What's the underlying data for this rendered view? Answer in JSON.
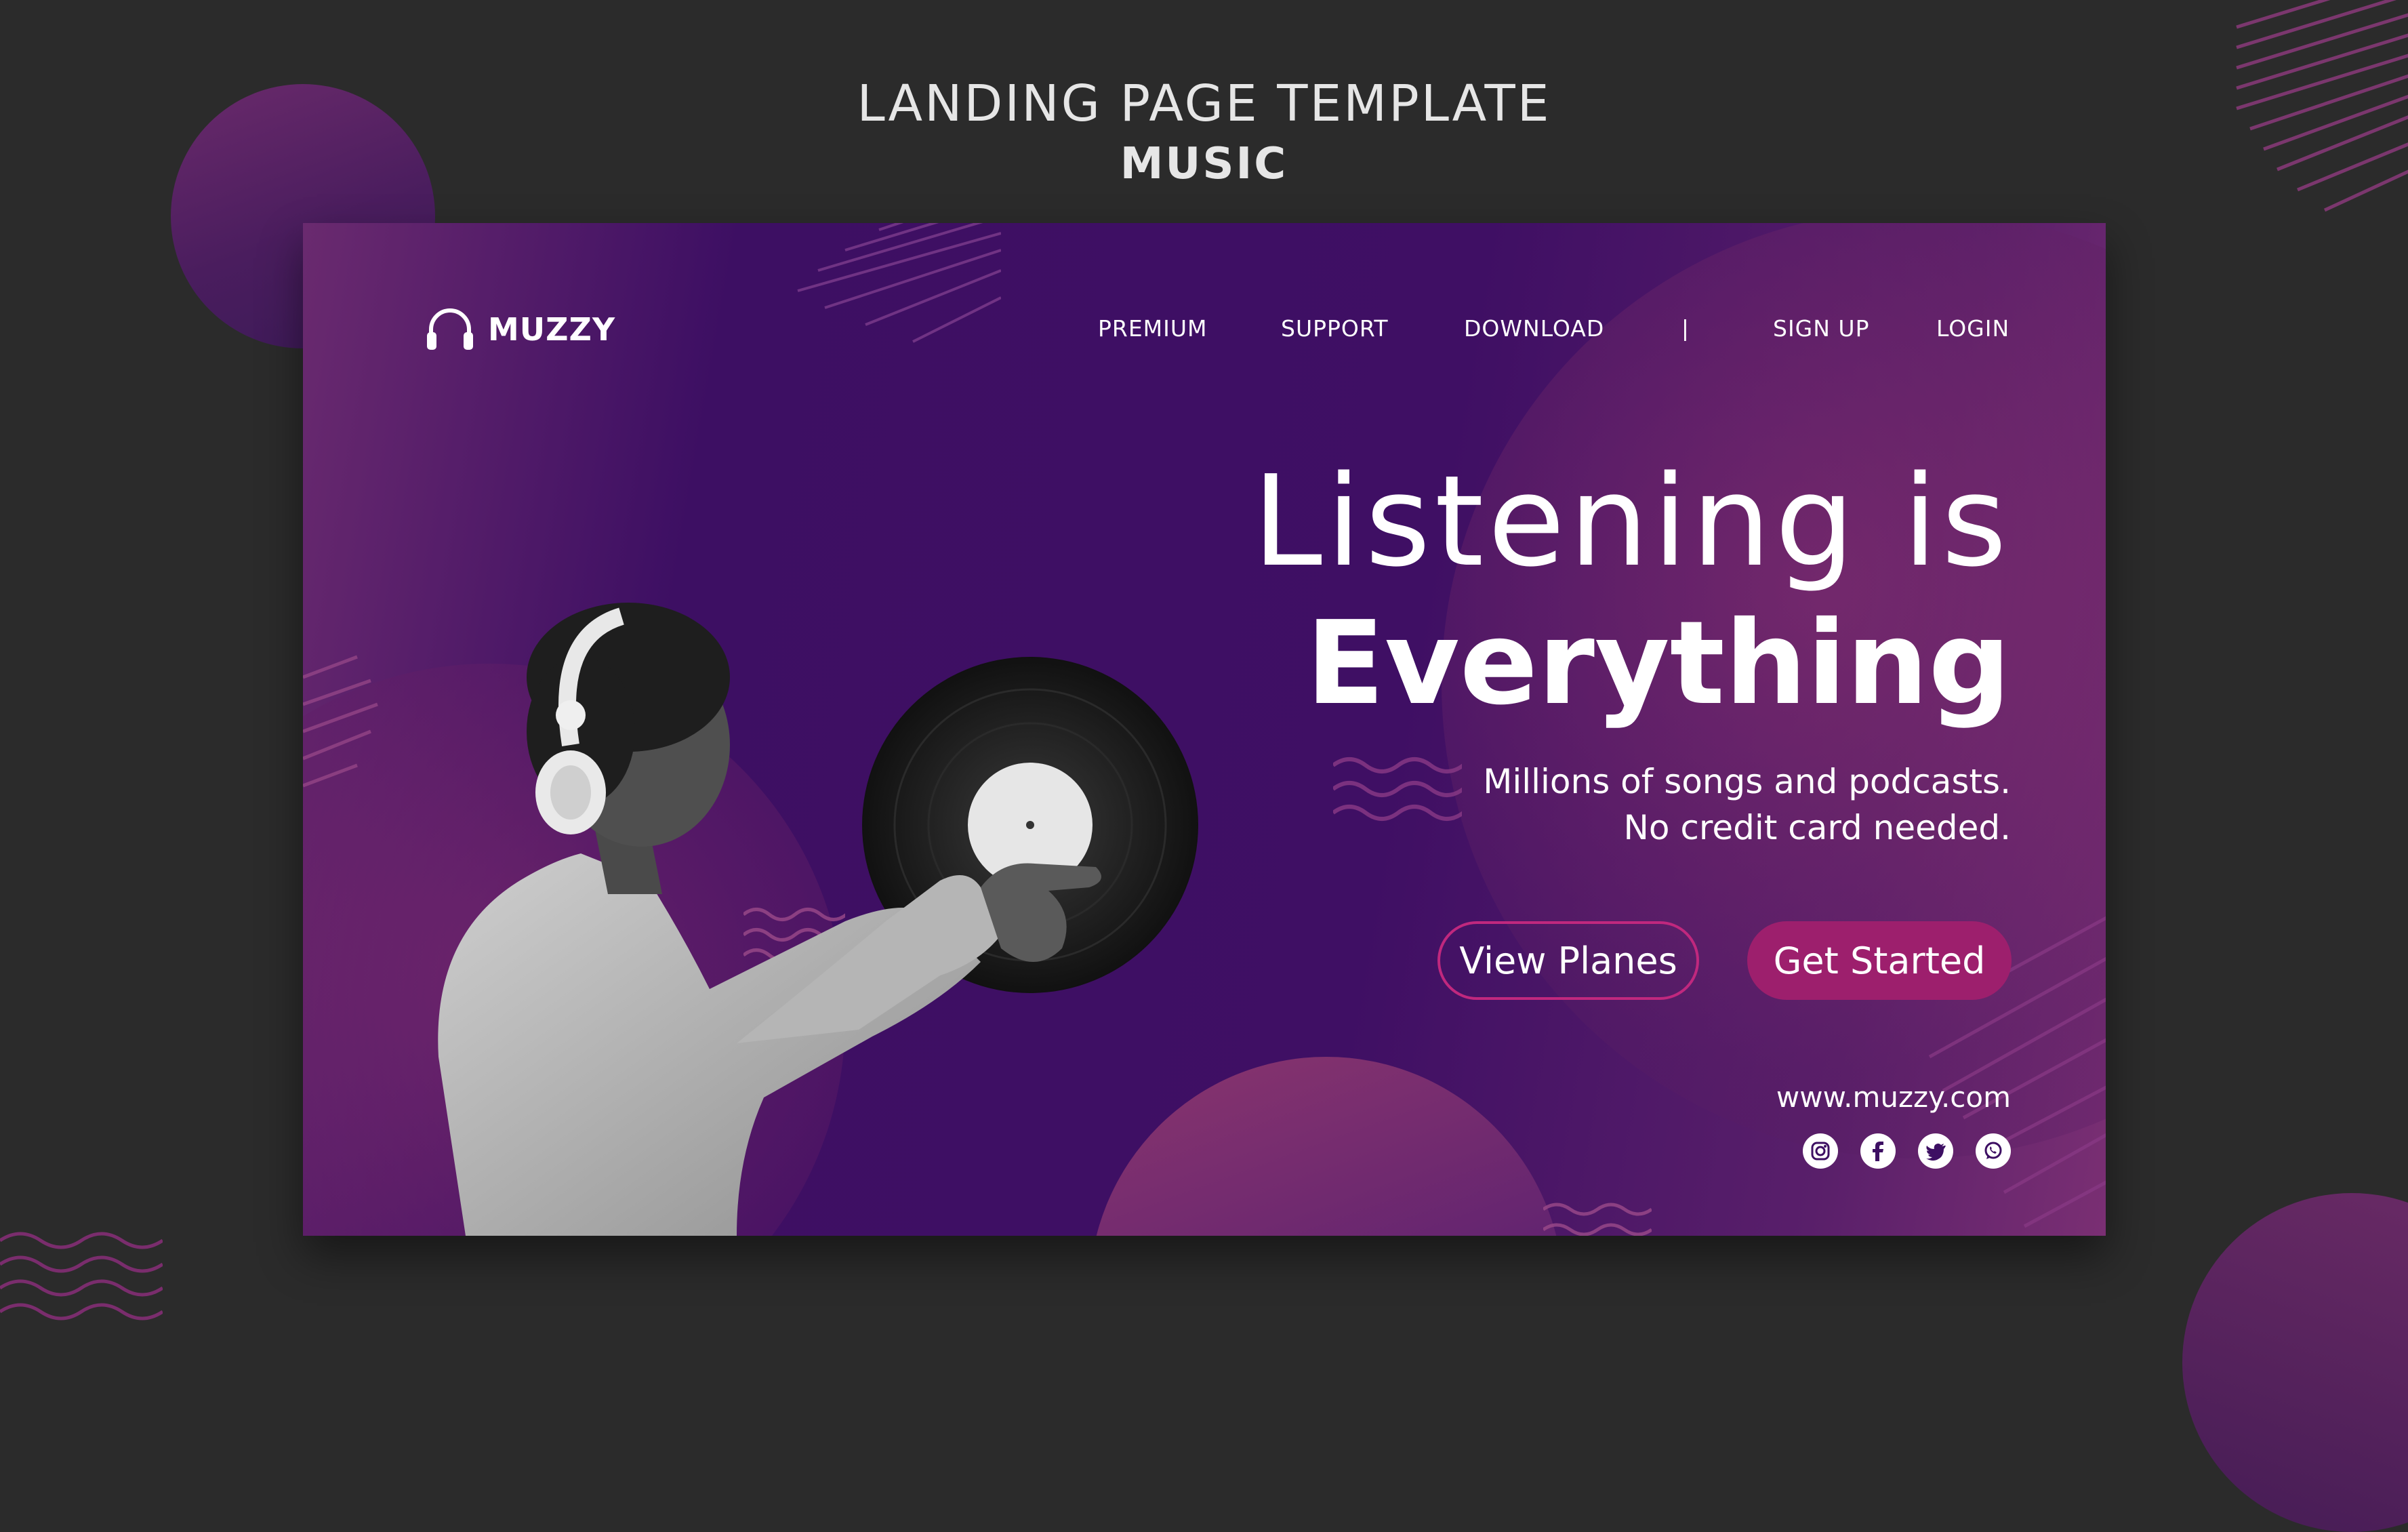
{
  "page": {
    "heading": "LANDING PAGE TEMPLATE",
    "subheading": "MUSIC"
  },
  "brand": {
    "name": "MUZZY",
    "logo_icon": "headphones-icon"
  },
  "nav": {
    "items": [
      {
        "label": "PREMIUM"
      },
      {
        "label": "SUPPORT"
      },
      {
        "label": "DOWNLOAD"
      }
    ],
    "separator": "|",
    "auth": [
      {
        "label": "SIGN UP"
      },
      {
        "label": "LOGIN"
      }
    ]
  },
  "hero": {
    "title_line1": "Listening is",
    "title_line2": "Everything",
    "subtitle_line1": "Millions of songs and podcasts.",
    "subtitle_line2": "No credit card needed.",
    "secondary_button": "View Planes",
    "primary_button": "Get Started"
  },
  "footer": {
    "url": "www.muzzy.com",
    "socials": [
      "instagram-icon",
      "facebook-icon",
      "twitter-icon",
      "whatsapp-icon"
    ]
  },
  "colors": {
    "background": "#2b2b2b",
    "card_purple": "#3d0f63",
    "accent_magenta": "#9d1f6d",
    "text": "#ffffff"
  }
}
